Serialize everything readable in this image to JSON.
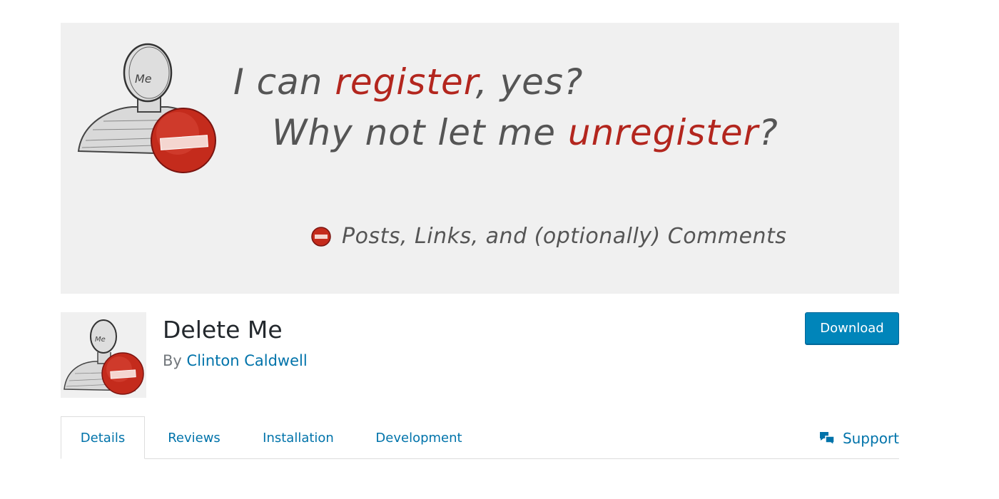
{
  "banner": {
    "line1_part1": "I can ",
    "line1_highlight": "register",
    "line1_part2": ", yes?",
    "line2_part1": "Why not let me ",
    "line2_highlight": "unregister",
    "line2_part2": "?",
    "bullet_text": "Posts, Links, and (optionally) Comments",
    "avatar_label": "Me"
  },
  "plugin": {
    "name": "Delete Me",
    "author_prefix": "By",
    "author_name": "Clinton Caldwell",
    "icon_label": "Me"
  },
  "actions": {
    "download_label": "Download"
  },
  "tabs": [
    {
      "label": "Details",
      "active": true
    },
    {
      "label": "Reviews",
      "active": false
    },
    {
      "label": "Installation",
      "active": false
    },
    {
      "label": "Development",
      "active": false
    }
  ],
  "support": {
    "label": "Support",
    "icon": "speech-bubbles-icon"
  },
  "colors": {
    "link": "#0073aa",
    "button": "#0085ba",
    "banner_bg": "#f0f0f0",
    "accent_red": "#b3261e"
  }
}
